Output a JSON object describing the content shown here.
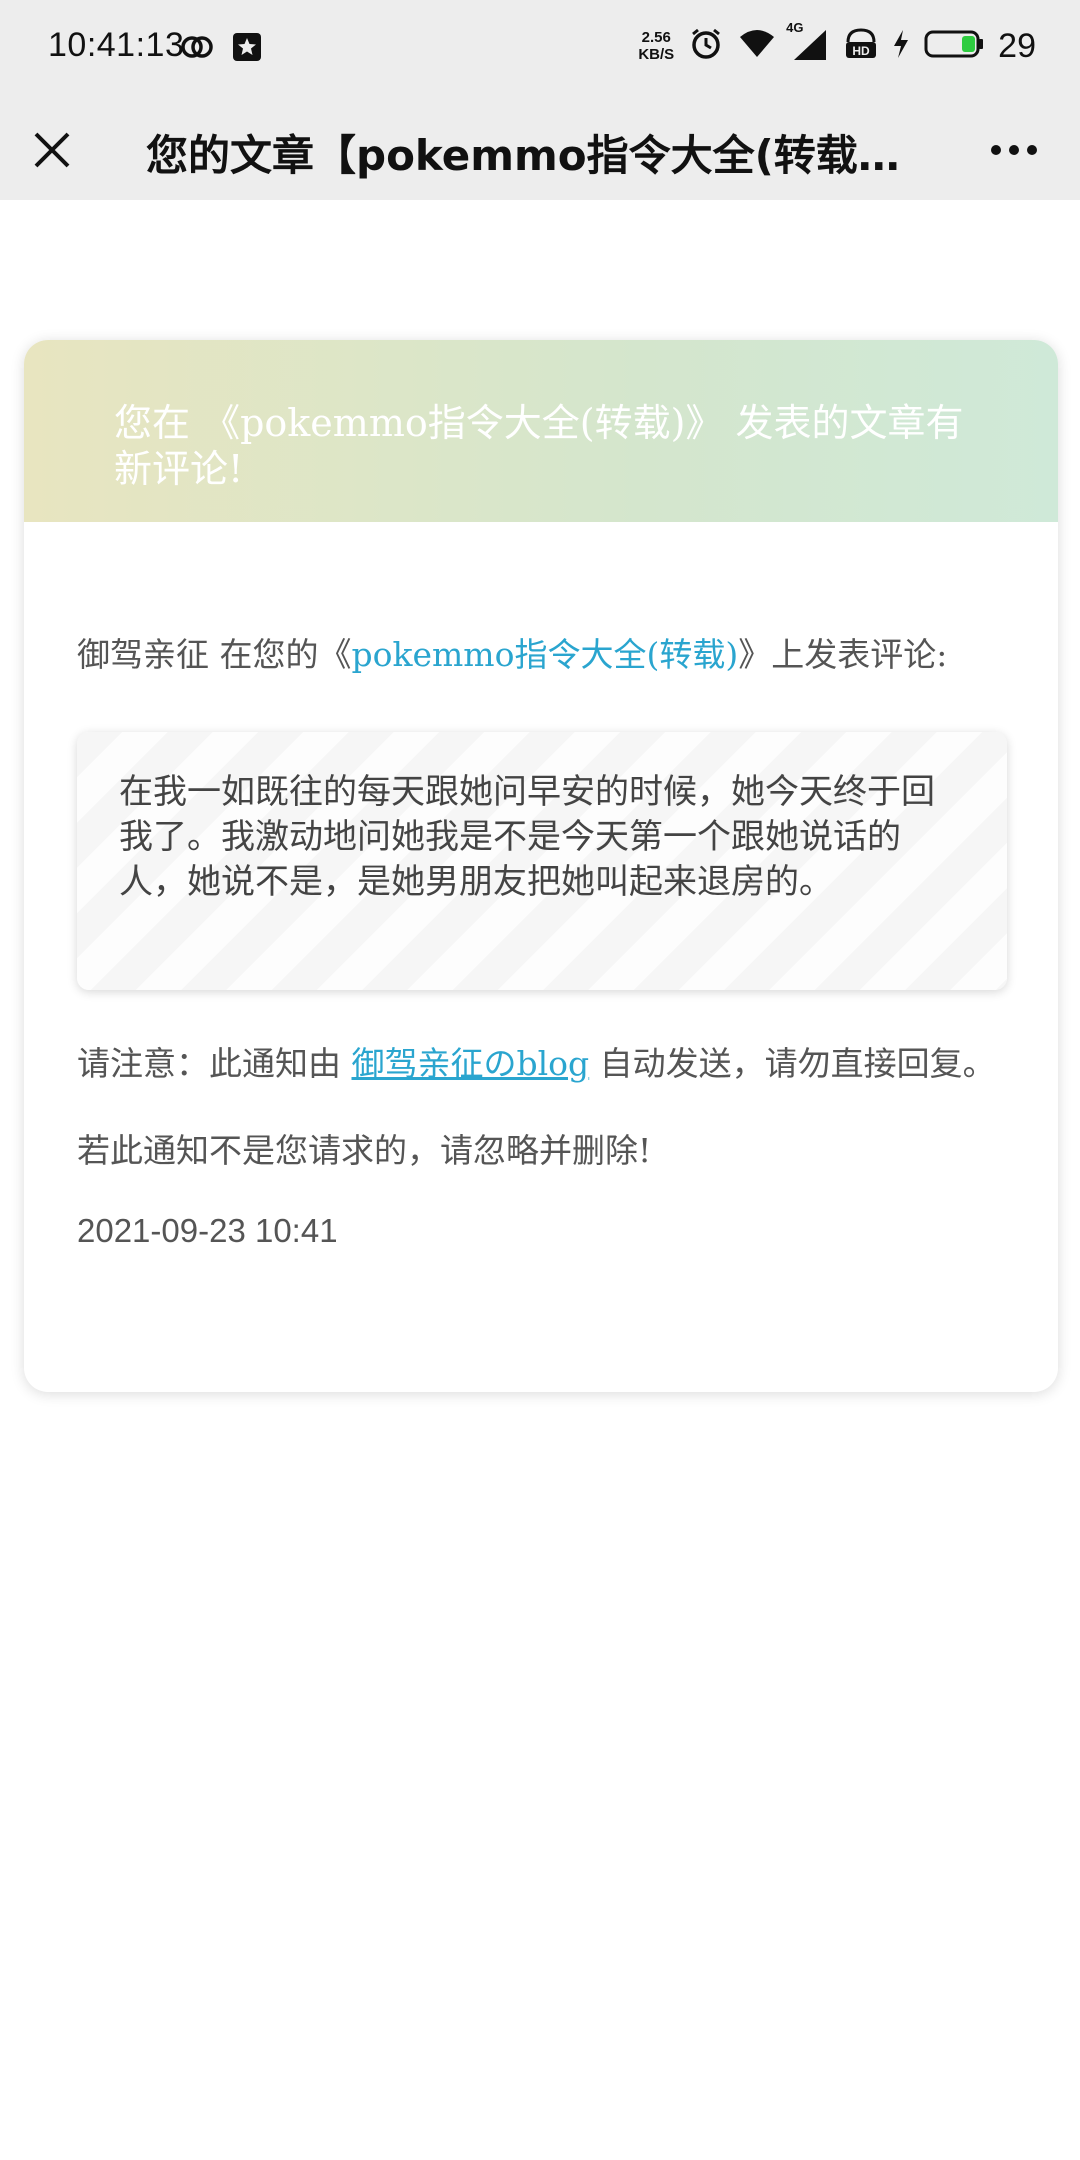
{
  "status_bar": {
    "time": "10:41:13",
    "speed_value": "2.56",
    "speed_unit": "KB/S",
    "network": "4G",
    "battery": "29",
    "icons": [
      "link-icon",
      "star-notification-icon",
      "alarm-icon",
      "wifi-icon",
      "signal-icon",
      "hd-icon",
      "charging-icon",
      "battery-icon"
    ],
    "battery_color": "#2ecc40"
  },
  "title_bar": {
    "title": "您的文章【pokemmo指令大全(转载)】…"
  },
  "card": {
    "header_text": "您在 《pokemmo指令大全(转载)》 发表的文章有新评论!",
    "comment_intro": {
      "author": "御驾亲征",
      "prefix": " 在您的《",
      "article": "pokemmo指令大全(转载)",
      "suffix": "》上发表评论:"
    },
    "comment_text": "在我一如既往的每天跟她问早安的时候，她今天终于回我了。我激动地问她我是不是今天第一个跟她说话的人，她说不是，是她男朋友把她叫起来退房的。",
    "notice": {
      "prefix": "请注意：此通知由 ",
      "blog_link": "御驾亲征のblog",
      "suffix": " 自动发送，请勿直接回复。"
    },
    "ignore_text": "若此通知不是您请求的，请忽略并删除!",
    "date": "2021-09-23 10:41"
  },
  "colors": {
    "accent_link": "#2aa5cf",
    "header_gradient_start": "#e8e5c0",
    "header_gradient_end": "#cfe9d8"
  }
}
